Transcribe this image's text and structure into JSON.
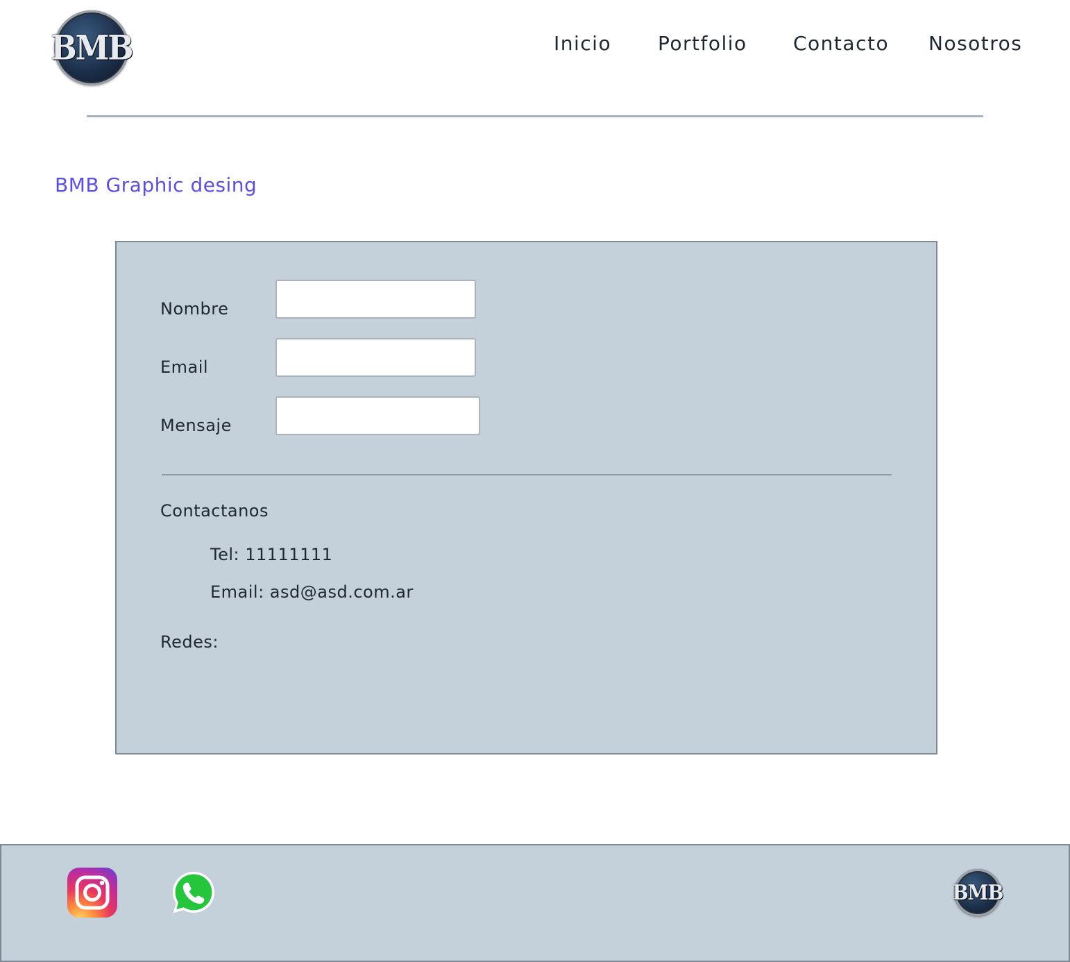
{
  "header": {
    "logo_text": "BMB",
    "nav": [
      {
        "label": "Inicio"
      },
      {
        "label": "Portfolio"
      },
      {
        "label": "Contacto"
      },
      {
        "label": "Nosotros"
      }
    ]
  },
  "brand_title": "BMB Graphic desing",
  "form": {
    "fields": [
      {
        "label": "Nombre",
        "value": ""
      },
      {
        "label": "Email",
        "value": ""
      },
      {
        "label": "Mensaje",
        "value": ""
      }
    ]
  },
  "contact": {
    "heading": "Contactanos",
    "tel": "Tel: 11111111",
    "email": "Email: asd@asd.com.ar",
    "social_heading": "Redes:"
  },
  "footer": {
    "icons": [
      "instagram-icon",
      "whatsapp-icon"
    ],
    "logo_text": "BMB"
  },
  "colors": {
    "accent_title": "#5b4ee6",
    "panel_bg": "#c4d0da",
    "panel_border": "#7d8a96"
  }
}
